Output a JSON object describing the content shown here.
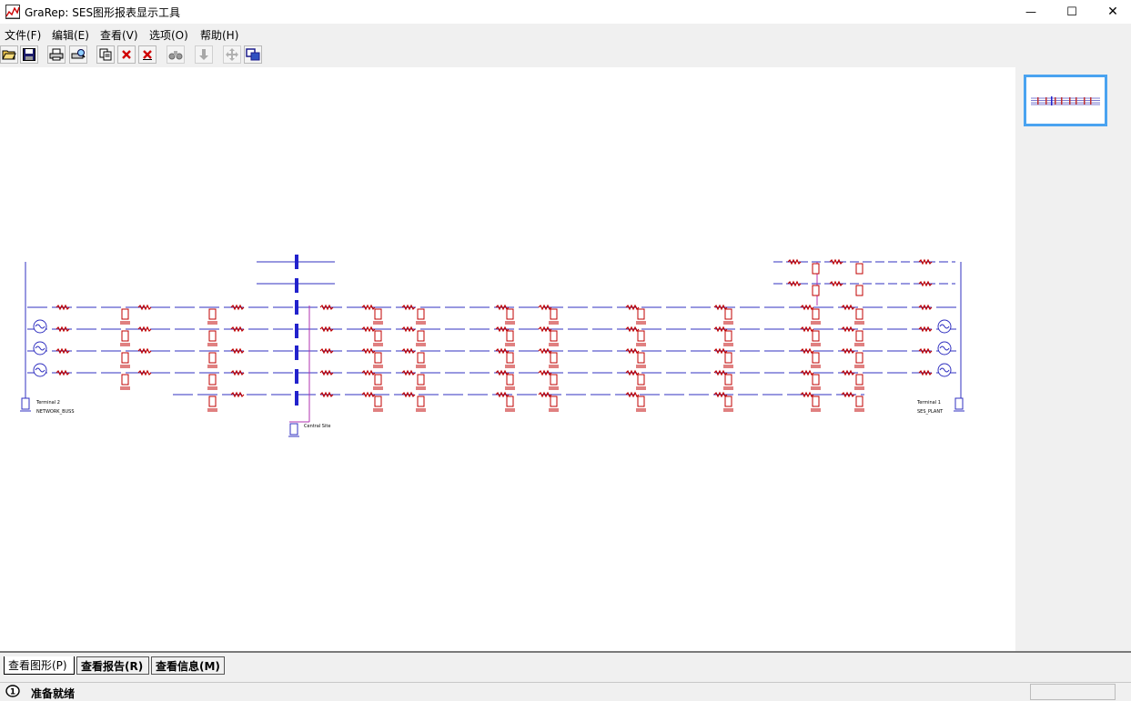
{
  "window": {
    "title": "GraRep: SES图形报表显示工具",
    "minimize_glyph": "—",
    "maximize_glyph": "☐",
    "close_glyph": "✕"
  },
  "menu": [
    {
      "label": "文件(F)"
    },
    {
      "label": "编辑(E)"
    },
    {
      "label": "查看(V)"
    },
    {
      "label": "选项(O)"
    },
    {
      "label": "帮助(H)"
    }
  ],
  "toolbar": {
    "buttons": [
      {
        "name": "open-icon",
        "glyph": "📂"
      },
      {
        "name": "save-icon",
        "glyph": "💾"
      },
      {
        "name": "print-icon",
        "glyph": "🖶"
      },
      {
        "name": "print-preview-icon",
        "glyph": "🖷"
      },
      {
        "name": "copy-icon",
        "glyph": "⎘"
      },
      {
        "name": "delete-icon",
        "glyph": "✕"
      },
      {
        "name": "delete-all-icon",
        "glyph": "✕"
      },
      {
        "name": "find-icon",
        "glyph": "⌕"
      },
      {
        "name": "down-arrow-icon",
        "glyph": "⬇"
      },
      {
        "name": "move-icon",
        "glyph": "✥"
      },
      {
        "name": "fit-window-icon",
        "glyph": "⧉"
      }
    ]
  },
  "diagram": {
    "labels": {
      "terminal_left": "Terminal 2",
      "network_left": "NETWORK_BUSS",
      "central_site": "Central Site",
      "terminal_right": "Terminal 1",
      "network_right": "SES_PLANT"
    },
    "colors": {
      "bus": "#3030c0",
      "element": "#c00000",
      "feeder": "#b030b0",
      "busbar": "#2222cc"
    }
  },
  "tabs": [
    {
      "label": "查看图形(P)"
    },
    {
      "label": "查看报告(R)"
    },
    {
      "label": "查看信息(M)"
    }
  ],
  "status": {
    "text": "准备就绪"
  }
}
